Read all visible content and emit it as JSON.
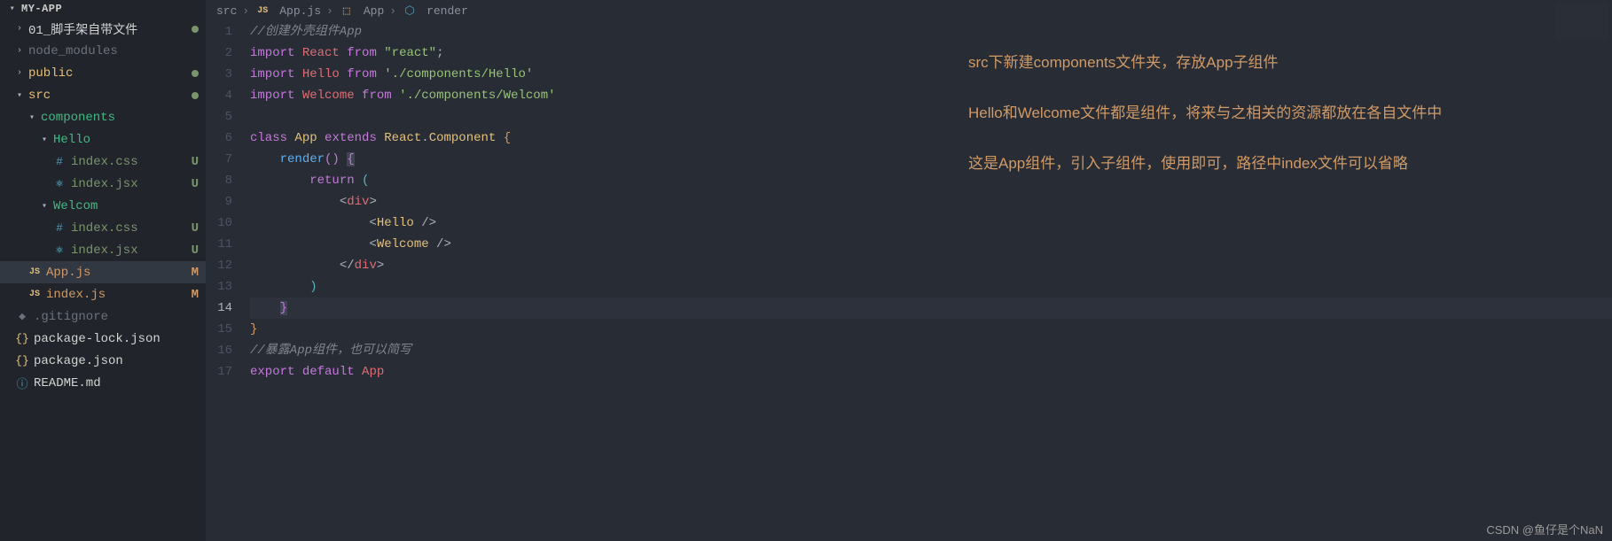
{
  "sidebar": {
    "title": "MY-APP",
    "items": [
      {
        "type": "folder",
        "label": "01_脚手架自带文件",
        "depth": 0,
        "expanded": false,
        "colorClass": "folder-white",
        "dot": true
      },
      {
        "type": "folder",
        "label": "node_modules",
        "depth": 0,
        "expanded": false,
        "colorClass": "folder-dim"
      },
      {
        "type": "folder",
        "label": "public",
        "depth": 0,
        "expanded": false,
        "colorClass": "folder-yellow",
        "dot": true
      },
      {
        "type": "folder",
        "label": "src",
        "depth": 0,
        "expanded": true,
        "colorClass": "folder-yellow",
        "dot": true
      },
      {
        "type": "folder",
        "label": "components",
        "depth": 1,
        "expanded": true,
        "colorClass": "folder-teal"
      },
      {
        "type": "folder",
        "label": "Hello",
        "depth": 2,
        "expanded": true,
        "colorClass": "folder-teal"
      },
      {
        "type": "file",
        "label": "index.css",
        "depth": 3,
        "iconClass": "hash",
        "icon": "#",
        "status": "U",
        "statusClass": "st-u",
        "colorClass": "st-u"
      },
      {
        "type": "file",
        "label": "index.jsx",
        "depth": 3,
        "iconClass": "react",
        "icon": "⚛",
        "status": "U",
        "statusClass": "st-u",
        "colorClass": "st-u"
      },
      {
        "type": "folder",
        "label": "Welcom",
        "depth": 2,
        "expanded": true,
        "colorClass": "folder-teal"
      },
      {
        "type": "file",
        "label": "index.css",
        "depth": 3,
        "iconClass": "hash",
        "icon": "#",
        "status": "U",
        "statusClass": "st-u",
        "colorClass": "st-u"
      },
      {
        "type": "file",
        "label": "index.jsx",
        "depth": 3,
        "iconClass": "react",
        "icon": "⚛",
        "status": "U",
        "statusClass": "st-u",
        "colorClass": "st-u"
      },
      {
        "type": "file",
        "label": "App.js",
        "depth": 1,
        "iconClass": "js",
        "icon": "JS",
        "status": "M",
        "statusClass": "st-m",
        "colorClass": "st-m",
        "active": true
      },
      {
        "type": "file",
        "label": "index.js",
        "depth": 1,
        "iconClass": "js",
        "icon": "JS",
        "status": "M",
        "statusClass": "st-m",
        "colorClass": "st-m"
      },
      {
        "type": "file",
        "label": ".gitignore",
        "depth": 0,
        "iconClass": "git",
        "icon": "◆",
        "colorClass": "folder-dim"
      },
      {
        "type": "file",
        "label": "package-lock.json",
        "depth": 0,
        "iconClass": "json",
        "icon": "{}",
        "colorClass": "folder-white"
      },
      {
        "type": "file",
        "label": "package.json",
        "depth": 0,
        "iconClass": "json",
        "icon": "{}",
        "colorClass": "folder-white"
      },
      {
        "type": "file",
        "label": "README.md",
        "depth": 0,
        "iconClass": "info",
        "icon": "ⓘ",
        "colorClass": "folder-white"
      }
    ]
  },
  "breadcrumb": {
    "parts": [
      {
        "text": "src"
      },
      {
        "icon": "JS",
        "iconClass": "js",
        "text": "App.js"
      },
      {
        "icon": "⬚",
        "iconClass": "json",
        "text": "App"
      },
      {
        "icon": "⬡",
        "iconClass": "hash",
        "text": "render"
      }
    ]
  },
  "code": {
    "currentLine": 14,
    "lines": [
      {
        "html": "<span class='tk-comment'>//创建外壳组件App</span>"
      },
      {
        "html": "<span class='tk-keyword'>import</span> <span class='tk-tag'>React</span> <span class='tk-keyword'>from</span> <span class='tk-string'>\"react\"</span><span class='tk-punc'>;</span>"
      },
      {
        "html": "<span class='tk-keyword'>import</span> <span class='tk-tag'>Hello</span> <span class='tk-keyword'>from</span> <span class='tk-string'>'./components/Hello'</span>"
      },
      {
        "html": "<span class='tk-keyword'>import</span> <span class='tk-tag'>Welcome</span> <span class='tk-keyword'>from</span> <span class='tk-string'>'./components/Welcom'</span>"
      },
      {
        "html": ""
      },
      {
        "html": "<span class='tk-keyword'>class</span> <span class='tk-class'>App</span> <span class='tk-keyword'>extends</span> <span class='tk-class'>React</span><span class='tk-punc'>.</span><span class='tk-class'>Component</span> <span class='tk-brace'>{</span>"
      },
      {
        "html": "    <span class='tk-func'>render</span><span class='tk-brace2'>()</span> <span class='cursor-sel tk-brace2'>{</span>"
      },
      {
        "html": "        <span class='tk-keyword'>return</span> <span class='tk-brace3'>(</span>"
      },
      {
        "html": "            <span class='tk-punc'>&lt;</span><span class='tk-tag'>div</span><span class='tk-punc'>&gt;</span>"
      },
      {
        "html": "                <span class='tk-punc'>&lt;</span><span class='tk-class'>Hello</span> <span class='tk-punc'>/&gt;</span>"
      },
      {
        "html": "                <span class='tk-punc'>&lt;</span><span class='tk-class'>Welcome</span> <span class='tk-punc'>/&gt;</span>"
      },
      {
        "html": "            <span class='tk-punc'>&lt;/</span><span class='tk-tag'>div</span><span class='tk-punc'>&gt;</span>"
      },
      {
        "html": "        <span class='tk-brace3'>)</span>"
      },
      {
        "html": "    <span class='cursor-sel tk-brace2'>}</span>",
        "hl": true
      },
      {
        "html": "<span class='tk-brace'>}</span>"
      },
      {
        "html": "<span class='tk-comment'>//暴露App组件，也可以简写</span>"
      },
      {
        "html": "<span class='tk-keyword'>export</span> <span class='tk-keyword'>default</span> <span class='tk-tag'>App</span>"
      }
    ]
  },
  "annotations": {
    "lines": [
      "src下新建components文件夹，存放App子组件",
      "Hello和Welcome文件都是组件，将来与之相关的资源都放在各自文件中",
      "这是App组件，引入子组件，使用即可，路径中index文件可以省略"
    ]
  },
  "watermark": "CSDN @鱼仔是个NaN"
}
